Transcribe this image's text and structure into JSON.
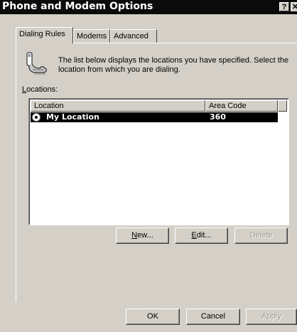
{
  "window": {
    "title": "Phone and Modem Options",
    "help_glyph": "?",
    "close_glyph": "✕"
  },
  "tabs": [
    {
      "label": "Dialing Rules",
      "active": true
    },
    {
      "label": "Modems",
      "active": false
    },
    {
      "label": "Advanced",
      "active": false
    }
  ],
  "dialing_rules": {
    "description": "The list below displays the locations you have specified. Select the location from which you are dialing.",
    "locations_label": "Locations:",
    "columns": [
      "Location",
      "Area Code"
    ],
    "rows": [
      {
        "location": "My Location",
        "area_code": "360",
        "selected": true
      }
    ],
    "buttons": {
      "new": {
        "pre": "",
        "accel": "N",
        "post": "ew..."
      },
      "edit": {
        "pre": "",
        "accel": "E",
        "post": "dit..."
      },
      "delete": {
        "label": "Delete"
      }
    }
  },
  "footer": {
    "ok": "OK",
    "cancel": "Cancel",
    "apply": "Apply"
  },
  "icons": {
    "phone": "phone-icon"
  }
}
